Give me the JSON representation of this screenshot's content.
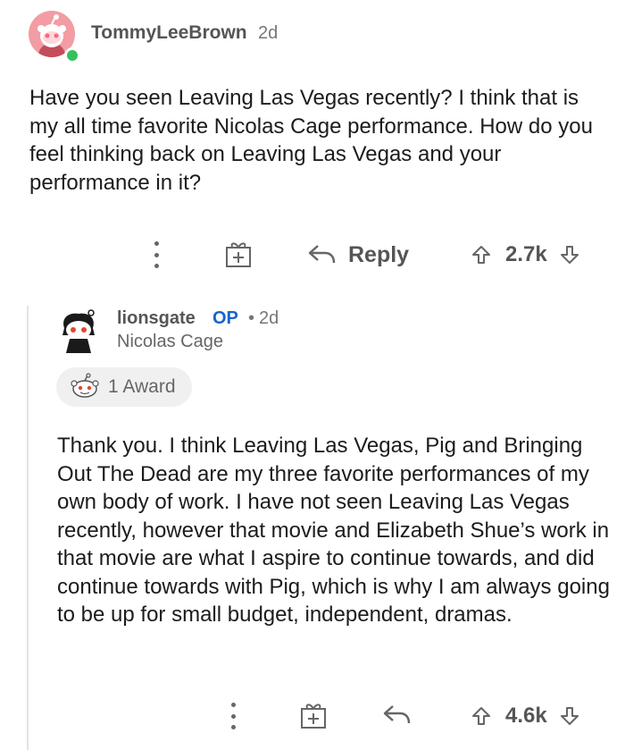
{
  "comment1": {
    "username": "TommyLeeBrown",
    "age": "2d",
    "body": "Have you seen Leaving Las Vegas recently? I think that is my all time favorite Nicolas Cage performance. How do you feel thinking back on Leaving Las Vegas and your performance in it?",
    "reply_label": "Reply",
    "votes": "2.7k"
  },
  "comment2": {
    "username": "lionsgate",
    "op_badge": "OP",
    "dot": "•",
    "age": "2d",
    "flair": "Nicolas Cage",
    "award_label": "1 Award",
    "body": "Thank you. I think Leaving Las Vegas, Pig and Bringing Out The Dead are my three favorite performances of my own body of work. I have not seen Leaving Las Vegas recently, however that movie and Elizabeth Shue’s work in that movie are what I aspire to continue towards, and did continue towards with Pig, which is why I am always going to be up for small budget, independent, dramas.",
    "votes": "4.6k"
  },
  "icons": {
    "more": "more-options-icon",
    "gift": "gift-award-icon",
    "reply": "reply-arrow-icon",
    "upvote": "upvote-arrow-icon",
    "downvote": "downvote-arrow-icon"
  },
  "colors": {
    "op_badge": "#1b62c9",
    "online": "#35c15c",
    "avatar_bg": "#f29ca3"
  }
}
